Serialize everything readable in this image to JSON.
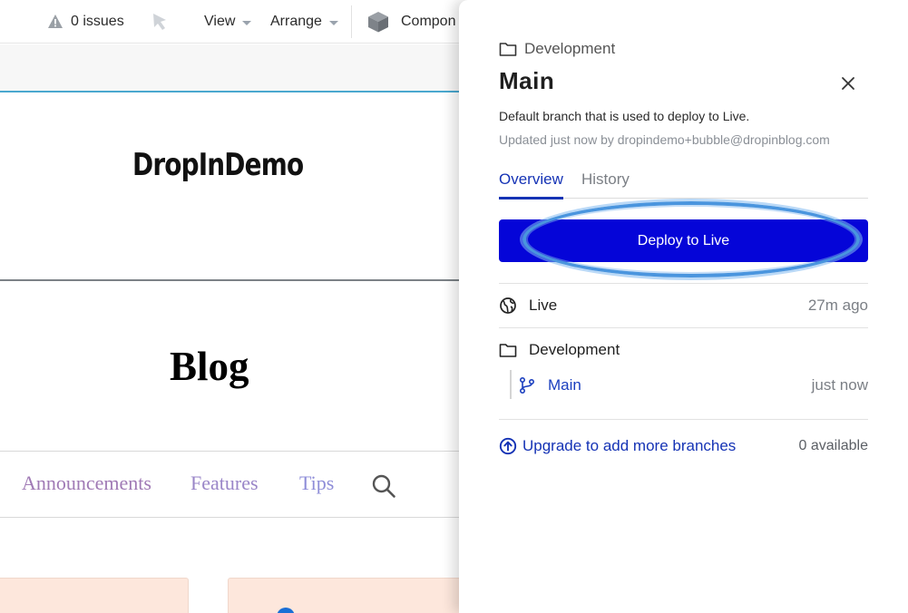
{
  "toolbar": {
    "issues_label": "0 issues",
    "view_label": "View",
    "arrange_label": "Arrange",
    "components_label": "Compon"
  },
  "site": {
    "logo_text": "DropInDemo",
    "blog_title": "Blog",
    "categories": [
      "Announcements",
      "Features",
      "Tips"
    ]
  },
  "panel": {
    "breadcrumb": "Development",
    "title": "Main",
    "description": "Default branch that is used to deploy to Live.",
    "updated": "Updated just now by dropindemo+bubble@dropinblog.com",
    "tabs": [
      {
        "label": "Overview",
        "active": true
      },
      {
        "label": "History",
        "active": false
      }
    ],
    "deploy_label": "Deploy to Live",
    "live": {
      "label": "Live",
      "time": "27m ago"
    },
    "development": {
      "label": "Development"
    },
    "main_branch": {
      "label": "Main",
      "time": "just now"
    },
    "upgrade": {
      "label": "Upgrade to add more branches",
      "count": "0 available"
    }
  },
  "colors": {
    "accent": "#1533b5",
    "deploy_button": "#0505d8",
    "highlight_ring": "#4a95de",
    "rule_accent": "#4aa8cf"
  }
}
